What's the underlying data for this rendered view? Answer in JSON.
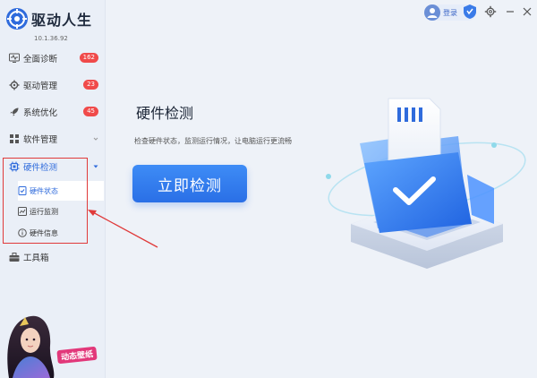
{
  "app": {
    "title": "驱动人生",
    "version": "10.1.36.92"
  },
  "sidebar": {
    "items": [
      {
        "label": "全面诊断",
        "badge": "162",
        "icon": "monitor-pulse-icon"
      },
      {
        "label": "驱动管理",
        "badge": "23",
        "icon": "gear-icon"
      },
      {
        "label": "系统优化",
        "badge": "45",
        "icon": "rocket-icon"
      },
      {
        "label": "软件管理",
        "badge": "",
        "icon": "grid-icon"
      },
      {
        "label": "硬件检测",
        "badge": "",
        "icon": "chip-icon"
      },
      {
        "label": "工具箱",
        "badge": "",
        "icon": "toolbox-icon"
      }
    ],
    "subitems": [
      {
        "label": "硬件状态",
        "icon": "hardware-status-icon",
        "active": true
      },
      {
        "label": "运行监测",
        "icon": "monitor-chart-icon",
        "active": false
      },
      {
        "label": "硬件信息",
        "icon": "info-icon",
        "active": false
      }
    ],
    "promo_label": "动态壁纸"
  },
  "topbar": {
    "login_label": "登录"
  },
  "main": {
    "title": "硬件检测",
    "description": "检查硬件状态，监测运行情况，让电脑运行更流畅",
    "scan_button": "立即检测"
  },
  "colors": {
    "accent": "#2f6bdc",
    "badge": "#f04a4a",
    "highlight": "#e03a3a"
  }
}
